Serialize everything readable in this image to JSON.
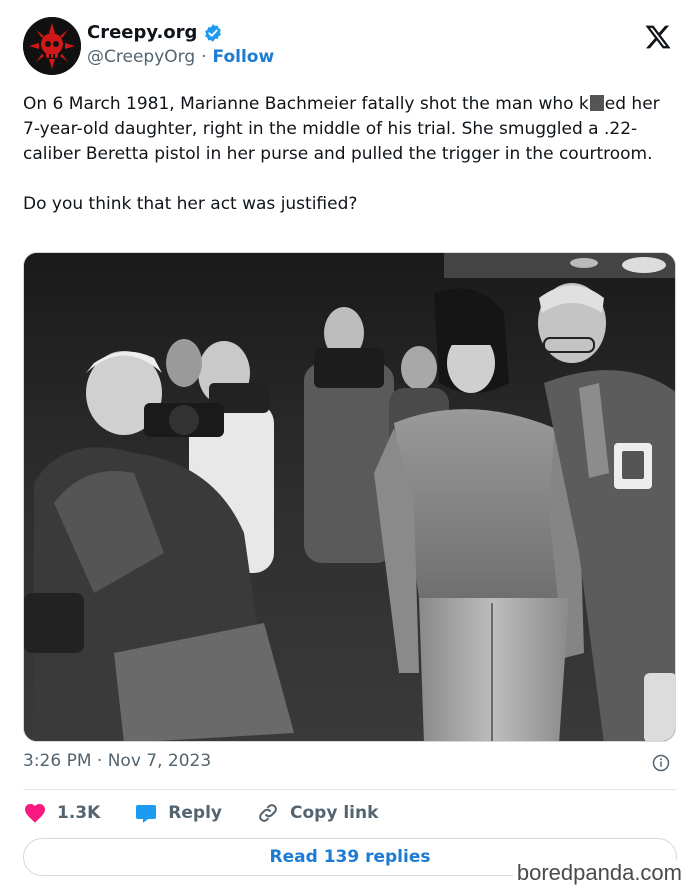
{
  "account": {
    "name": "Creepy.org",
    "handle": "@CreepyOrg",
    "separator": "·",
    "follow_label": "Follow",
    "verified_color": "#1d9bf0"
  },
  "tweet": {
    "text_parts": {
      "before_redact": "On 6 March 1981, Marianne Bachmeier fatally shot the man who k",
      "after_redact": "ed her 7-year-old daughter, right in the middle of his trial. She smuggled a .22-caliber Beretta pistol in her purse and pulled the trigger in the courtroom."
    },
    "question": "Do you think that her act was justified?",
    "image_alt": "Black-and-white photo of a courtroom with photographers taking pictures of a woman escorted by an officer"
  },
  "meta": {
    "time": "3:26 PM",
    "separator": "·",
    "date": "Nov 7, 2023"
  },
  "actions": {
    "likes": "1.3K",
    "reply_label": "Reply",
    "copy_label": "Copy link"
  },
  "read_replies_label": "Read 139 replies",
  "watermark": "boredpanda.com",
  "colors": {
    "link_blue": "#1d7bd4",
    "like_pink": "#f91880",
    "reply_blue": "#1d9bf0",
    "muted_text": "#536471"
  }
}
